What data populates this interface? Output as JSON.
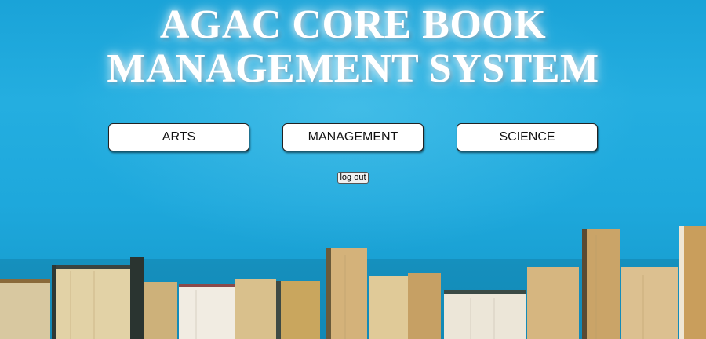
{
  "header": {
    "title": "AGAC CORE BOOK MANAGEMENT SYSTEM"
  },
  "departments": [
    {
      "label": "ARTS"
    },
    {
      "label": "MANAGEMENT"
    },
    {
      "label": "SCIENCE"
    }
  ],
  "logout_label": "log out",
  "background": {
    "image": "books-on-shelf-photo",
    "colors": {
      "sky": "#1ea8dc",
      "page": "#e8dcb8",
      "cover_dark": "#2f3a36"
    }
  }
}
